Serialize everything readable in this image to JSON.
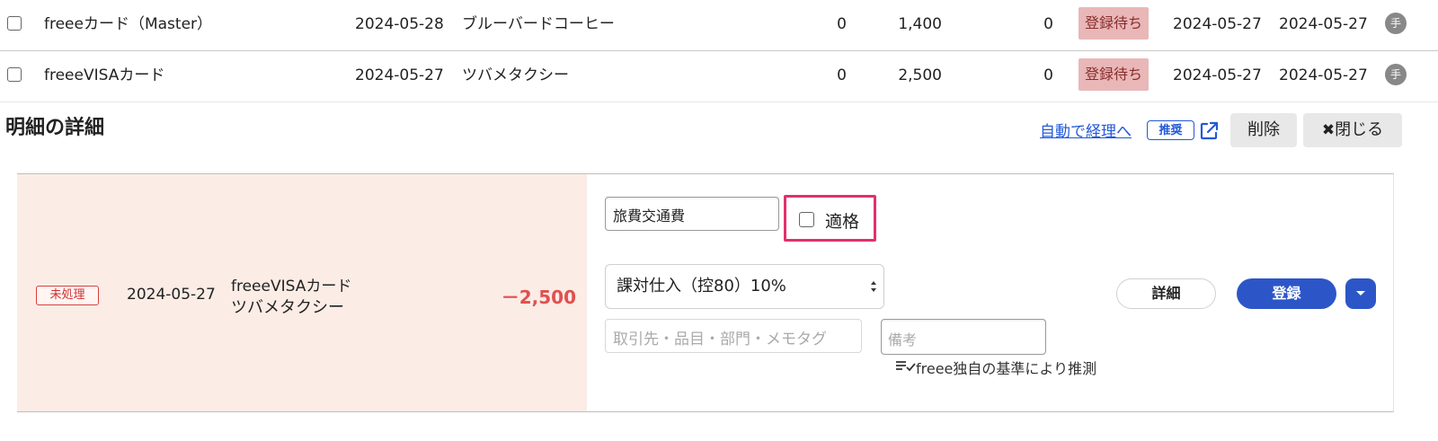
{
  "rows": [
    {
      "card": "freeeカード（Master）",
      "date": "2024-05-28",
      "vendor": "ブルーバードコーヒー",
      "n1": "0",
      "n2": "1,400",
      "n3": "0",
      "status": "登録待ち",
      "date2": "2024-05-27",
      "date3": "2024-05-27",
      "hand": "手"
    },
    {
      "card": "freeeVISAカード",
      "date": "2024-05-27",
      "vendor": "ツバメタクシー",
      "n1": "0",
      "n2": "2,500",
      "n3": "0",
      "status": "登録待ち",
      "date2": "2024-05-27",
      "date3": "2024-05-27",
      "hand": "手"
    }
  ],
  "detail": {
    "title": "明細の詳細",
    "auto_link": "自動で経理へ",
    "recommend_badge": "推奨",
    "delete_label": "削除",
    "close_icon": "✖",
    "close_label": "閉じる",
    "status": "未処理",
    "date": "2024-05-27",
    "card": "freeeVISAカード",
    "vendor": "ツバメタクシー",
    "amount": "－2,500",
    "account": "旅費交通費",
    "qualified_label": "適格",
    "tax_category": "課対仕入（控80）10%",
    "partner_placeholder": "取引先・品目・部門・メモタグ",
    "memo_placeholder": "備考",
    "guess_text": "freee独自の基準により推測",
    "detail_button": "詳細",
    "register_button": "登録"
  },
  "colors": {
    "accent": "#2c56c8",
    "link": "#2259d8",
    "highlight_border": "#e0316a",
    "amount_negative": "#e05050",
    "panel_bg": "#fbece5",
    "wait_badge_bg": "#e9b7b7"
  }
}
